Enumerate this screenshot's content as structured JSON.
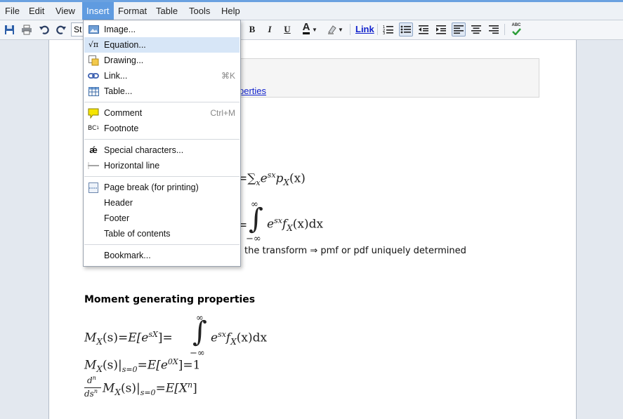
{
  "menubar": {
    "items": [
      {
        "label": "File"
      },
      {
        "label": "Edit"
      },
      {
        "label": "View"
      },
      {
        "label": "Insert"
      },
      {
        "label": "Format"
      },
      {
        "label": "Table"
      },
      {
        "label": "Tools"
      },
      {
        "label": "Help"
      }
    ],
    "active": "Insert"
  },
  "toolbar": {
    "style_value": "St",
    "bold": "B",
    "italic": "I",
    "underline": "U",
    "font_color": "A",
    "link": "Link",
    "spell": "ABC"
  },
  "insert_menu": {
    "items": [
      {
        "label": "Image...",
        "shortcut": "",
        "icon": "image-icon"
      },
      {
        "label": "Equation...",
        "shortcut": "",
        "icon": "equation-icon"
      },
      {
        "label": "Drawing...",
        "shortcut": "",
        "icon": "drawing-icon"
      },
      {
        "label": "Link...",
        "shortcut": "⌘K",
        "icon": "link-icon"
      },
      {
        "label": "Table...",
        "shortcut": "",
        "icon": "table-icon"
      },
      {
        "label": "Comment",
        "shortcut": "Ctrl+M",
        "icon": "comment-icon"
      },
      {
        "label": "Footnote",
        "shortcut": "",
        "icon": "footnote-icon"
      },
      {
        "label": "Special characters...",
        "shortcut": "",
        "icon": "special-characters-icon"
      },
      {
        "label": "Horizontal line",
        "shortcut": "",
        "icon": "horizontal-line-icon"
      },
      {
        "label": "Page break (for printing)",
        "shortcut": "",
        "icon": "page-break-icon"
      },
      {
        "label": "Header",
        "shortcut": "",
        "icon": ""
      },
      {
        "label": "Footer",
        "shortcut": "",
        "icon": ""
      },
      {
        "label": "Table of contents",
        "shortcut": "",
        "icon": ""
      },
      {
        "label": "Bookmark...",
        "shortcut": "",
        "icon": ""
      }
    ],
    "highlighted": "Equation..."
  },
  "document": {
    "box_link": "perties",
    "eq_discrete_eq": "=",
    "eq_discrete_sum": "∑",
    "eq_discrete_sub": "x",
    "eq_discrete_e": "e",
    "eq_discrete_sup": "sx",
    "eq_discrete_p": "p",
    "eq_discrete_psub": "X",
    "eq_discrete_arg": "(x)",
    "eq_cont_eq": "=",
    "eq_cont_int": "∫",
    "eq_cont_upper": "∞",
    "eq_cont_lower": "−∞",
    "eq_cont_e": "e",
    "eq_cont_sup": "sx",
    "eq_cont_f": "f",
    "eq_cont_fsub": "X",
    "eq_cont_arg": "(x)dx",
    "uniqueness_text": "the transform ⇒ pmf or pdf uniquely determined",
    "section_heading": "Moment generating properties",
    "mgf_lhs": "M",
    "mgf_lhs_sub": "X",
    "mgf_lhs_arg": "(s)",
    "mgf_eq1": "=",
    "mgf_E": "E[e",
    "mgf_E_sup": "sX",
    "mgf_E_close": "]",
    "mgf_eq2": "=",
    "mgf_int": "∫",
    "mgf_int_upper": "∞",
    "mgf_int_lower": "−∞",
    "mgf_e": "e",
    "mgf_e_sup": "sx",
    "mgf_f": "f",
    "mgf_fsub": "X",
    "mgf_farg": "(x)dx",
    "m0_M": "M",
    "m0_sub": "X",
    "m0_arg": "(s)|",
    "m0_eval": "s=0",
    "m0_eq": "=",
    "m0_E": "E[e",
    "m0_E_sup": "0X",
    "m0_close": "]",
    "m0_eq2": "=",
    "m0_one": "1",
    "dn_num": "d",
    "dn_num_sup": "n",
    "dn_den": "ds",
    "dn_den_sup": "n",
    "dn_M": "M",
    "dn_sub": "X",
    "dn_arg": "(s)|",
    "dn_eval": "s=0",
    "dn_eq": "=",
    "dn_E": "E[X",
    "dn_E_sup": "n",
    "dn_close": "]"
  },
  "colors": {
    "menu_active": "#5f9be0",
    "menu_hover": "#d7e6f7",
    "link": "#1122cc"
  }
}
